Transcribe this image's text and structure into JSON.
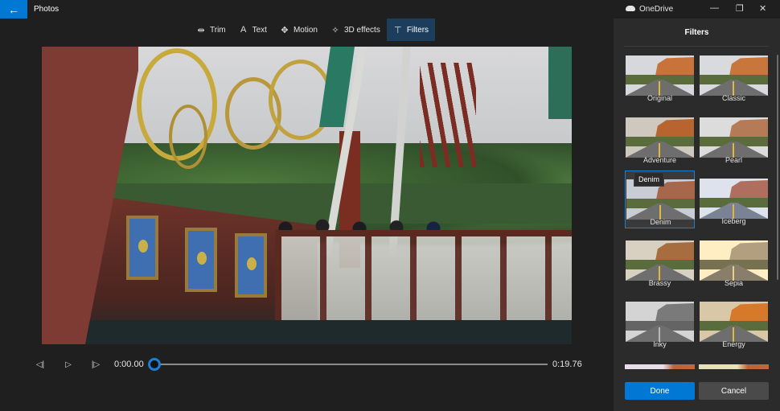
{
  "app": {
    "title": "Photos",
    "back_icon": "arrow-left-icon"
  },
  "window": {
    "title": "OneDrive",
    "cloud_icon": "cloud-icon",
    "minimize_glyph": "—",
    "restore_glyph": "❐",
    "close_glyph": "✕"
  },
  "toolbar": {
    "items": [
      {
        "label": "Trim",
        "icon": "trim-icon",
        "glyph": "⇹",
        "active": false
      },
      {
        "label": "Text",
        "icon": "text-icon",
        "glyph": "A",
        "active": false
      },
      {
        "label": "Motion",
        "icon": "motion-icon",
        "glyph": "✥",
        "active": false
      },
      {
        "label": "3D effects",
        "icon": "3d-effects-icon",
        "glyph": "✧",
        "active": false
      },
      {
        "label": "Filters",
        "icon": "filters-icon",
        "glyph": "⊤",
        "active": true
      }
    ]
  },
  "playback": {
    "prev_frame_glyph": "◁|",
    "play_glyph": "▷",
    "next_frame_glyph": "|▷",
    "current_time": "0:00.00",
    "total_time": "0:19.76",
    "progress_fraction": 0.0
  },
  "filters_panel": {
    "title": "Filters",
    "tooltip": "Denim",
    "selected": "Denim",
    "items": [
      {
        "label": "Original",
        "tint": "#d6d8dc",
        "cliff": "#c8733a"
      },
      {
        "label": "Classic",
        "tint": "#d8dade",
        "cliff": "#c8763c"
      },
      {
        "label": "Adventure",
        "tint": "#cfc8be",
        "cliff": "#b8642e"
      },
      {
        "label": "Pearl",
        "tint": "#dcdcdc",
        "cliff": "#b57a56"
      },
      {
        "label": "Denim",
        "tint": "#c9ccd4",
        "cliff": "#a8674c"
      },
      {
        "label": "Iceberg",
        "tint": "#dde2ec",
        "cliff": "#b06f5e"
      },
      {
        "label": "Brassy",
        "tint": "#d8d0c0",
        "cliff": "#a86d3e"
      },
      {
        "label": "Sepia",
        "tint": "#d6d0c4",
        "cliff": "#9a8a76"
      },
      {
        "label": "Inky",
        "tint": "#d4d4d4",
        "cliff": "#7a7a7a"
      },
      {
        "label": "Energy",
        "tint": "#d8c8a8",
        "cliff": "#d8782a"
      }
    ],
    "done_label": "Done",
    "cancel_label": "Cancel"
  }
}
